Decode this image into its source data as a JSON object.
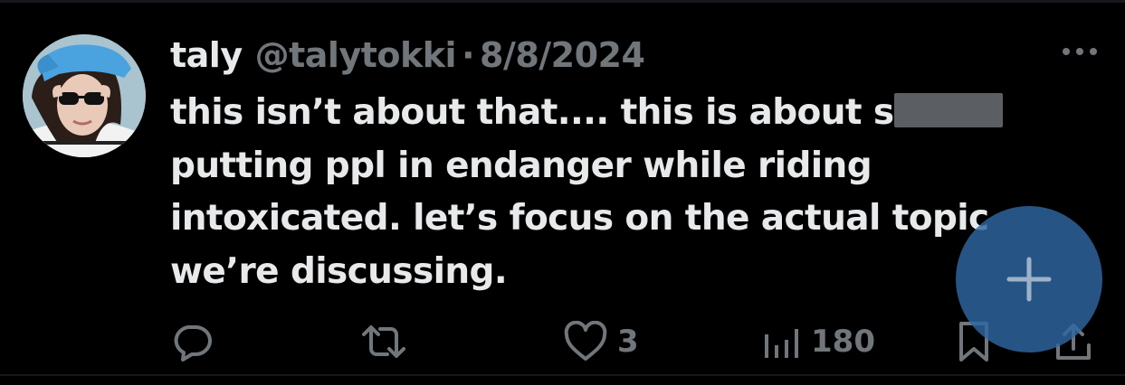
{
  "tweet": {
    "author": {
      "display_name": "taly",
      "handle": "@talytokki",
      "avatar_icon": "user-avatar"
    },
    "separator": "·",
    "date": "8/8/2024",
    "text_lines": [
      "this isn’t about that.... this is about s",
      "putting ppl in endanger while riding",
      "intoxicated. let’s focus on the actual topic",
      "we’re discussing."
    ]
  },
  "actions": {
    "reply_icon": "reply-icon",
    "retweet_icon": "retweet-icon",
    "like": {
      "icon": "heart-icon",
      "count": "3"
    },
    "views": {
      "icon": "views-chart-icon",
      "count": "180"
    },
    "bookmark_icon": "bookmark-icon",
    "share_icon": "share-icon"
  },
  "fab": {
    "icon": "plus-icon"
  },
  "colors": {
    "background": "#000000",
    "primary_text": "#e7e9ea",
    "secondary_text": "#71767b",
    "fab": "#2e68a2"
  }
}
